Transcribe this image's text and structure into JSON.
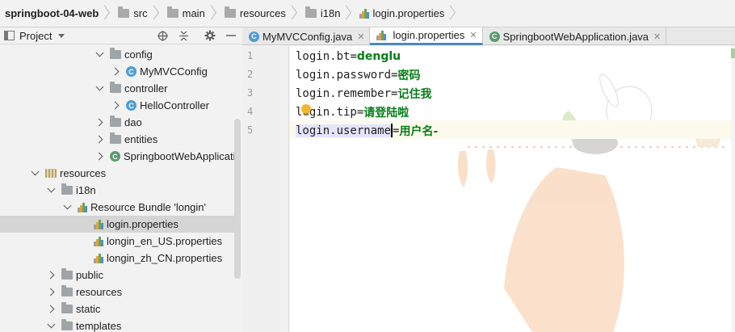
{
  "breadcrumb": [
    {
      "label": "springboot-04-web",
      "icon": "none"
    },
    {
      "label": "src",
      "icon": "folder-icon"
    },
    {
      "label": "main",
      "icon": "folder-icon"
    },
    {
      "label": "resources",
      "icon": "folder-icon"
    },
    {
      "label": "i18n",
      "icon": "folder-icon"
    },
    {
      "label": "login.properties",
      "icon": "properties-file-icon"
    }
  ],
  "project_panel": {
    "title": "Project",
    "tools": [
      "target-icon",
      "collapse-icon",
      "gear-icon",
      "minimize-icon"
    ]
  },
  "tree": [
    {
      "label": "config",
      "indent": 5,
      "caret": "down",
      "icon": "package"
    },
    {
      "label": "MyMVCConfig",
      "indent": 6,
      "caret": "right",
      "icon": "class"
    },
    {
      "label": "controller",
      "indent": 5,
      "caret": "down",
      "icon": "package"
    },
    {
      "label": "HelloController",
      "indent": 6,
      "caret": "right",
      "icon": "class"
    },
    {
      "label": "dao",
      "indent": 5,
      "caret": "right",
      "icon": "package"
    },
    {
      "label": "entities",
      "indent": 5,
      "caret": "right",
      "icon": "package"
    },
    {
      "label": "SpringbootWebApplicatio",
      "indent": 5,
      "caret": "right",
      "icon": "spring-class"
    },
    {
      "label": "resources",
      "indent": 1,
      "caret": "down",
      "icon": "resources"
    },
    {
      "label": "i18n",
      "indent": 2,
      "caret": "down",
      "icon": "folder"
    },
    {
      "label": "Resource Bundle 'longin'",
      "indent": 3,
      "caret": "down",
      "icon": "bundle"
    },
    {
      "label": "login.properties",
      "indent": 4,
      "caret": "none",
      "icon": "properties",
      "selected": true
    },
    {
      "label": "longin_en_US.properties",
      "indent": 4,
      "caret": "none",
      "icon": "properties"
    },
    {
      "label": "longin_zh_CN.properties",
      "indent": 4,
      "caret": "none",
      "icon": "properties"
    },
    {
      "label": "public",
      "indent": 2,
      "caret": "right",
      "icon": "folder"
    },
    {
      "label": "resources",
      "indent": 2,
      "caret": "right",
      "icon": "folder"
    },
    {
      "label": "static",
      "indent": 2,
      "caret": "right",
      "icon": "folder"
    },
    {
      "label": "templates",
      "indent": 2,
      "caret": "down",
      "icon": "folder"
    }
  ],
  "tabs": [
    {
      "label": "MyMVCConfig.java",
      "icon": "class",
      "active": false
    },
    {
      "label": "login.properties",
      "icon": "properties",
      "active": true
    },
    {
      "label": "SpringbootWebApplication.java",
      "icon": "spring-class",
      "active": false
    }
  ],
  "editor": {
    "lines": [
      {
        "num": "1",
        "key": "login.bt",
        "value": "denglu"
      },
      {
        "num": "2",
        "key": "login.password",
        "value": "密码"
      },
      {
        "num": "3",
        "key": "login.remember",
        "value": "记住我"
      },
      {
        "num": "4",
        "key": "login.tip",
        "value": "请登陆啦"
      },
      {
        "num": "5",
        "key": "login.username",
        "value": "用户名-"
      }
    ],
    "current_line": 5
  },
  "colors": {
    "accent": "#4a88c7",
    "value_green": "#067d17",
    "selection": "#d5d5d5"
  }
}
